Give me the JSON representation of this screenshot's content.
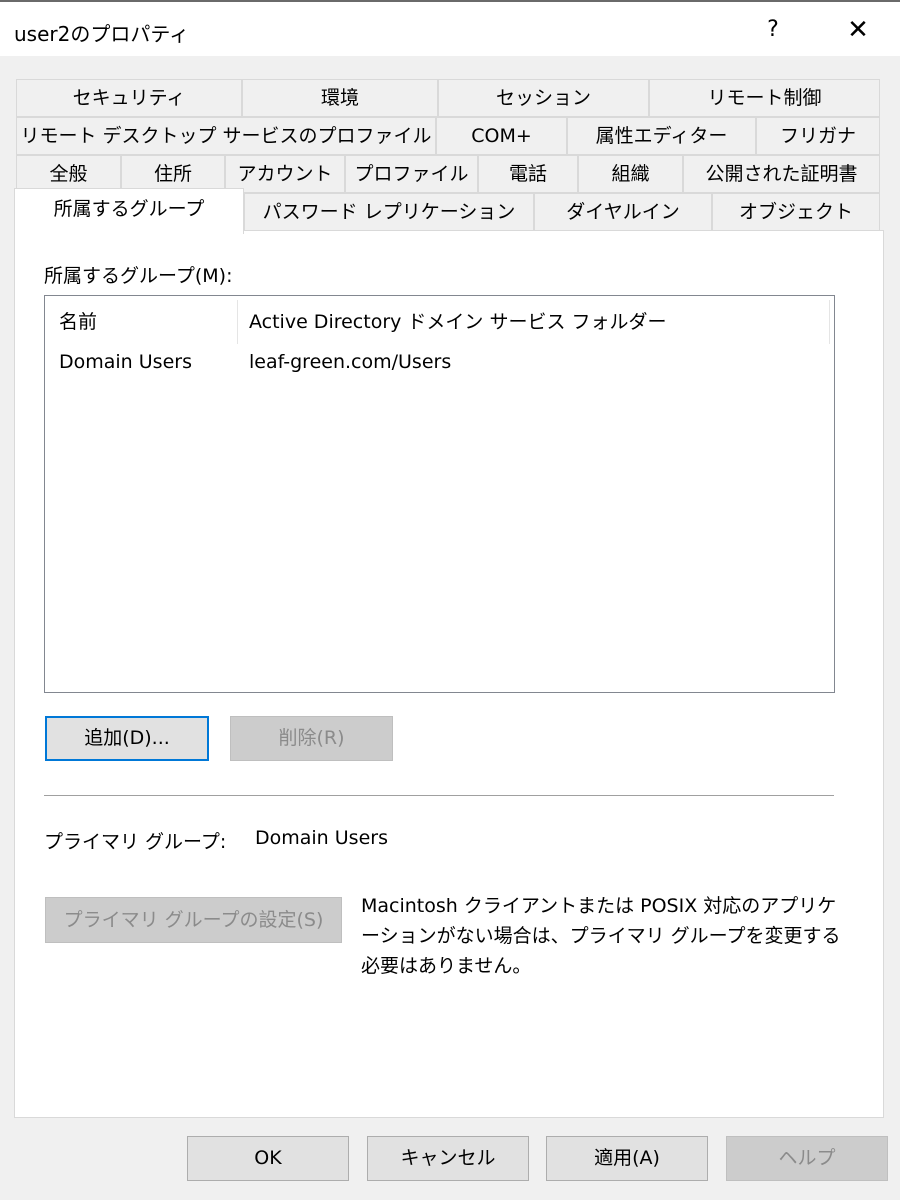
{
  "window": {
    "title": "user2のプロパティ",
    "help_label": "?",
    "close_label": "✕"
  },
  "tabs": {
    "row1": [
      "セキュリティ",
      "環境",
      "セッション",
      "リモート制御"
    ],
    "row2": [
      "リモート デスクトップ サービスのプロファイル",
      "COM+",
      "属性エディター",
      "フリガナ"
    ],
    "row3": [
      "全般",
      "住所",
      "アカウント",
      "プロファイル",
      "電話",
      "組織",
      "公開された証明書"
    ],
    "row4": [
      "所属するグループ",
      "パスワード レプリケーション",
      "ダイヤルイン",
      "オブジェクト"
    ],
    "active": "所属するグループ"
  },
  "member_of": {
    "label": "所属するグループ(M):",
    "columns": [
      "名前",
      "Active Directory ドメイン サービス フォルダー"
    ],
    "rows": [
      {
        "name": "Domain Users",
        "folder": "leaf-green.com/Users"
      }
    ],
    "add_button": "追加(D)...",
    "remove_button": "削除(R)"
  },
  "primary_group": {
    "label": "プライマリ グループ:",
    "value": "Domain Users",
    "set_button": "プライマリ グループの設定(S)",
    "note_line1": "Macintosh クライアントまたは POSIX 対応のアプリケ",
    "note_line2": "ーションがない場合は、プライマリ グループを変更する",
    "note_line3": "必要はありません。"
  },
  "footer": {
    "ok": "OK",
    "cancel": "キャンセル",
    "apply": "適用(A)",
    "help": "ヘルプ"
  }
}
